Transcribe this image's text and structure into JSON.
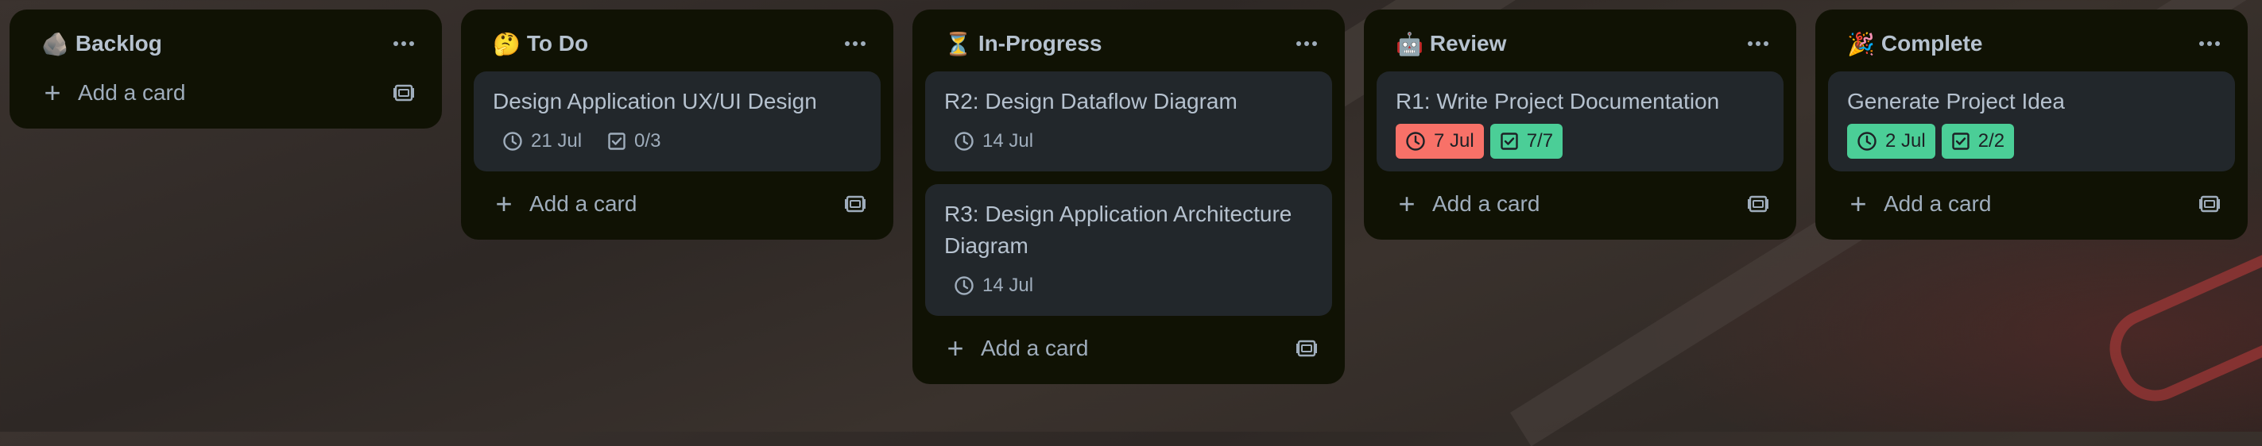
{
  "lists": [
    {
      "emoji": "🪨",
      "title": "Backlog",
      "cards": [],
      "add_label": "Add a card"
    },
    {
      "emoji": "🤔",
      "title": "To Do",
      "cards": [
        {
          "title": "Design Application UX/UI Design",
          "date": "21 Jul",
          "checklist": "0/3"
        }
      ],
      "add_label": "Add a card"
    },
    {
      "emoji": "⏳",
      "title": "In-Progress",
      "cards": [
        {
          "title": "R2: Design Dataflow Diagram",
          "date": "14 Jul"
        },
        {
          "title": "R3: Design Application Architecture Diagram",
          "date": "14 Jul"
        }
      ],
      "add_label": "Add a card"
    },
    {
      "emoji": "🤖",
      "title": "Review",
      "cards": [
        {
          "title": "R1: Write Project Documentation",
          "date": "7 Jul",
          "checklist": "7/7"
        }
      ],
      "add_label": "Add a card"
    },
    {
      "emoji": "🎉",
      "title": "Complete",
      "cards": [
        {
          "title": "Generate Project Idea",
          "date": "2 Jul",
          "checklist": "2/2"
        }
      ],
      "add_label": "Add a card"
    }
  ],
  "icons": {
    "menu": "more-horizontal-icon",
    "add": "plus-icon",
    "template": "card-template-icon",
    "date": "clock-icon",
    "checklist": "checkbox-icon"
  },
  "colors": {
    "list_bg": "#101204",
    "card_bg": "#22272b",
    "text": "#b6c2cf",
    "overdue": "#f87168",
    "complete": "#4bce97"
  }
}
